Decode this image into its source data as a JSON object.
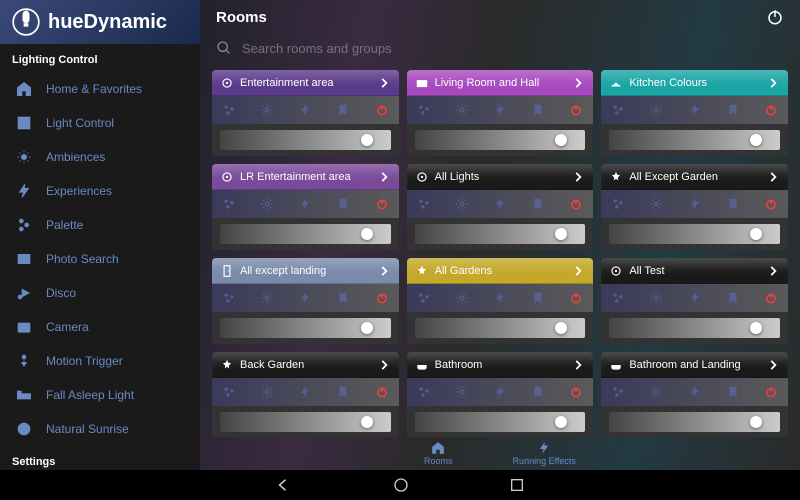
{
  "brand": "hueDynamic",
  "sections": {
    "lighting": "Lighting Control",
    "settings": "Settings"
  },
  "nav": [
    {
      "label": "Home & Favorites"
    },
    {
      "label": "Light Control"
    },
    {
      "label": "Ambiences"
    },
    {
      "label": "Experiences"
    },
    {
      "label": "Palette"
    },
    {
      "label": "Photo Search"
    },
    {
      "label": "Disco"
    },
    {
      "label": "Camera"
    },
    {
      "label": "Motion Trigger"
    },
    {
      "label": "Fall Asleep Light"
    },
    {
      "label": "Natural Sunrise"
    }
  ],
  "header": {
    "title": "Rooms"
  },
  "search": {
    "placeholder": "Search rooms and groups"
  },
  "rooms": [
    {
      "name": "Entertainment area",
      "color": "#5a3a8a"
    },
    {
      "name": "Living Room and Hall",
      "color": "#a84abf"
    },
    {
      "name": "Kitchen Colours",
      "color": "#1aa5a5"
    },
    {
      "name": "LR Entertainment area",
      "color": "#7a4a9a"
    },
    {
      "name": "All Lights",
      "color": "#1a1a1a"
    },
    {
      "name": "All Except Garden",
      "color": "#1a1a1a"
    },
    {
      "name": "All except landing",
      "color": "#7a8aaa"
    },
    {
      "name": "All Gardens",
      "color": "#c4a82a"
    },
    {
      "name": "All Test",
      "color": "#1a1a1a"
    },
    {
      "name": "Back Garden",
      "color": "#1a1a1a"
    },
    {
      "name": "Bathroom",
      "color": "#1a1a1a"
    },
    {
      "name": "Bathroom and Landing",
      "color": "#1a1a1a"
    }
  ],
  "tabs": {
    "rooms": "Rooms",
    "effects": "Running Effects"
  }
}
